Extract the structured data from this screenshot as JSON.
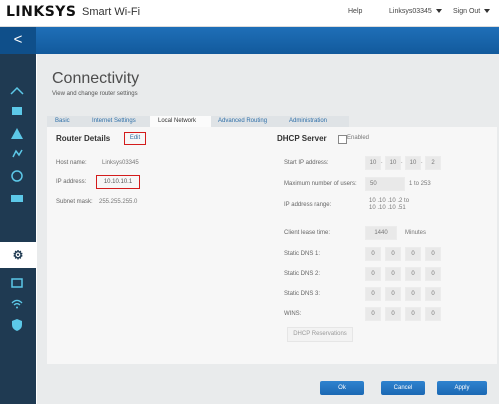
{
  "header": {
    "logo": "LINKSYS",
    "product": "Smart Wi-Fi",
    "help": "Help",
    "user": "Linksys03345",
    "sign_out": "Sign Out"
  },
  "nav": {
    "back": "<"
  },
  "page": {
    "title": "Connectivity",
    "subtitle": "View and change router settings"
  },
  "tabs": [
    "Basic",
    "Internet Settings",
    "Local Network",
    "Advanced Routing",
    "Administration"
  ],
  "router_details": {
    "heading": "Router Details",
    "edit": "Edit",
    "host_label": "Host name:",
    "host_value": "Linksys03345",
    "ip_label": "IP address:",
    "ip_value": "10.10.10.1",
    "mask_label": "Subnet mask:",
    "mask_value": "255.255.255.0"
  },
  "dhcp": {
    "heading": "DHCP Server",
    "enabled_label": "Enabled",
    "start_ip_label": "Start IP address:",
    "start_ip": [
      "10",
      "10",
      "10",
      "2"
    ],
    "max_users_label": "Maximum number of users:",
    "max_users": "50",
    "max_users_range": "1 to 253",
    "range_label": "IP address range:",
    "range_line1": "10 .10 .10 .2  to",
    "range_line2": "10 .10 .10 .51",
    "lease_label": "Client lease time:",
    "lease_value": "1440",
    "lease_unit": "Minutes",
    "dns1_label": "Static DNS 1:",
    "dns1": [
      "0",
      "0",
      "0",
      "0"
    ],
    "dns2_label": "Static DNS 2:",
    "dns2": [
      "0",
      "0",
      "0",
      "0"
    ],
    "dns3_label": "Static DNS 3:",
    "dns3": [
      "0",
      "0",
      "0",
      "0"
    ],
    "wins_label": "WINS:",
    "wins": [
      "0",
      "0",
      "0",
      "0"
    ],
    "reservations": "DHCP Reservations"
  },
  "footer": {
    "ok": "Ok",
    "cancel": "Cancel",
    "apply": "Apply"
  },
  "sidebar_icons": [
    "network-map-icon",
    "media-prioritization-icon",
    "alert-icon",
    "usb-storage-icon",
    "speed-test-icon",
    "external-storage-icon",
    "connectivity-gear-icon",
    "device-list-icon",
    "wireless-icon",
    "security-icon"
  ]
}
